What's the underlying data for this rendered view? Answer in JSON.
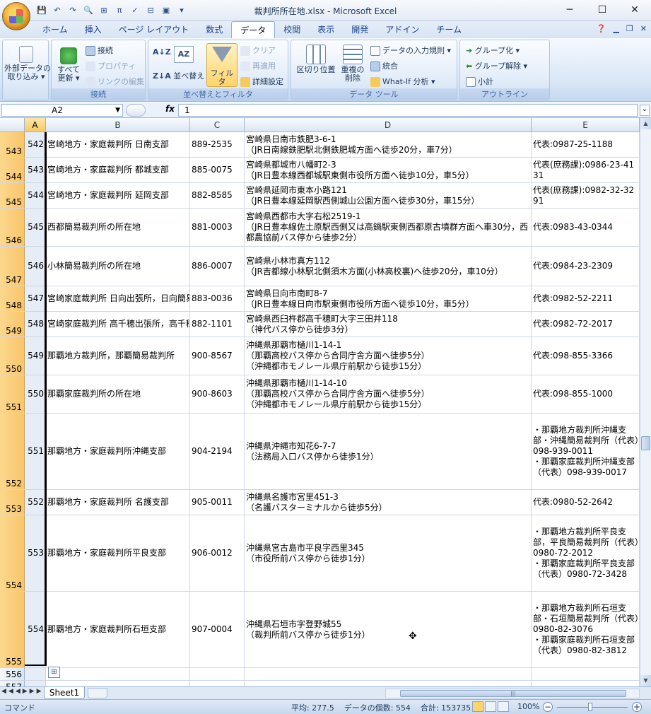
{
  "window": {
    "title": "裁判所所在地.xlsx - Microsoft Excel",
    "controls": [
      "─",
      "☐",
      "✕"
    ]
  },
  "qat": [
    "💾",
    "↶",
    "↷",
    "🔍",
    "⊞",
    "π",
    "✓",
    "⊟",
    "▣",
    "▾"
  ],
  "tabs": [
    "ホーム",
    "挿入",
    "ページ レイアウト",
    "数式",
    "データ",
    "校閲",
    "表示",
    "開発",
    "アドイン",
    "チーム"
  ],
  "active_tab": "データ",
  "ribbon": {
    "external_data": "外部データの\n取り込み ▾",
    "connections": {
      "refresh_all": "すべて\n更新 ▾",
      "connect": "接続",
      "properties": "プロパティ",
      "edit_links": "リンクの編集",
      "group": "接続"
    },
    "sort_filter": {
      "sort": "並べ替え",
      "filter": "フィルタ",
      "clear": "クリア",
      "reapply": "再適用",
      "advanced": "詳細設定",
      "group": "並べ替えとフィルタ"
    },
    "data_tools": {
      "text_to_columns": "区切り位置",
      "remove_duplicates": "重複の\n削除",
      "validation": "データの入力規則 ▾",
      "consolidate": "統合",
      "whatif": "What-If 分析 ▾",
      "group": "データ ツール"
    },
    "outline": {
      "group_btn": "グループ化 ▾",
      "ungroup": "グループ解除 ▾",
      "subtotal": "小計",
      "group": "アウトライン"
    }
  },
  "formula_bar": {
    "name_box": "A2",
    "fx": "fx",
    "value": "1"
  },
  "columns": [
    "A",
    "B",
    "C",
    "D",
    "E"
  ],
  "rows": [
    {
      "num": "543",
      "a": "542",
      "b": "宮崎地方・家庭裁判所 日南支部",
      "c": "889-2535",
      "d": "宮崎県日南市鉄肥3-6-1\n（JR日南線鉄肥駅北側鉄肥城方面へ徒歩20分，車7分）",
      "e": "代表:0987-25-1188",
      "h": 36
    },
    {
      "num": "544",
      "a": "543",
      "b": "宮崎地方・家庭裁判所 都城支部",
      "c": "885-0075",
      "d": "宮崎県都城市八幡町2-3\n（JR日豊本線西都城駅東側市役所方面へ徒歩10分，車5分）",
      "e": "代表(庶務課):0986-23-4131",
      "h": 36
    },
    {
      "num": "545",
      "a": "544",
      "b": "宮崎地方・家庭裁判所 延岡支部",
      "c": "882-8585",
      "d": "宮崎県延岡市東本小路121\n（JR日豊本線延岡駅西側城山公園方面へ徒歩30分，車15分）",
      "e": "代表(庶務課):0982-32-3291",
      "h": 36
    },
    {
      "num": "546",
      "a": "545",
      "b": "西都簡易裁判所の所在地",
      "c": "881-0003",
      "d": "宮崎県西都市大字右松2519-1\n（JR日豊本線佐土原駅西側又は高鍋駅東側西都原古墳群方面へ車30分，西都農協前バス停から徒歩2分）",
      "e": "代表:0983-43-0344",
      "h": 54
    },
    {
      "num": "547",
      "a": "546",
      "b": "小林簡易裁判所の所在地",
      "c": "886-0007",
      "d": "宮崎県小林市真方112\n（JR吉都線小林駅北側須木方面(小林高校裏)へ徒歩20分，車10分）",
      "e": "代表:0984-23-2309",
      "h": 56
    },
    {
      "num": "548",
      "a": "547",
      "b": "宮崎家庭裁判所 日向出張所，日向簡易裁判所",
      "c": "883-0036",
      "d": "宮崎県日向市南町8-7\n（JR日豊本線日向市駅東側市役所方面へ徒歩10分，車5分）",
      "e": "代表:0982-52-2211",
      "h": 36
    },
    {
      "num": "549",
      "a": "548",
      "b": "宮崎家庭裁判所 高千穂出張所，高千穂簡易裁判所",
      "c": "882-1101",
      "d": "宮崎県西臼杵郡高千穂町大字三田井118\n（神代バス停から徒歩3分）",
      "e": "代表:0982-72-2017",
      "h": 36
    },
    {
      "num": "550",
      "a": "549",
      "b": "那覇地方裁判所，那覇簡易裁判所",
      "c": "900-8567",
      "d": "沖縄県那覇市樋川1-14-1\n（那覇高校バス停から合同庁舎方面へ徒歩5分）\n（沖縄都市モノレール県庁前駅から徒歩15分）",
      "e": "代表:098-855-3366",
      "h": 54
    },
    {
      "num": "551",
      "a": "550",
      "b": "那覇家庭裁判所の所在地",
      "c": "900-8603",
      "d": "沖縄県那覇市樋川1-14-10\n（那覇高校バス停から合同庁舎方面へ徒歩5分）\n（沖縄都市モノレール県庁前駅から徒歩15分）",
      "e": "代表:098-855-1000",
      "h": 54
    },
    {
      "num": "552",
      "a": "551",
      "b": "那覇地方・家庭裁判所沖縄支部",
      "c": "904-2194",
      "d": "沖縄県沖縄市知花6-7-7\n（法務局入口バス停から徒歩1分）",
      "e": "・那覇地方裁判所沖縄支部・沖縄簡易裁判所（代表）098-939-0011\n・那覇家庭裁判所沖縄支部（代表）098-939-0017",
      "h": 108
    },
    {
      "num": "553",
      "a": "552",
      "b": "那覇地方・家庭裁判所 名護支部",
      "c": "905-0011",
      "d": "沖縄県名護市宮里451-3\n（名護バスターミナルから徒歩5分）",
      "e": "代表:0980-52-2642",
      "h": 36
    },
    {
      "num": "554",
      "a": "553",
      "b": "那覇地方・家庭裁判所平良支部",
      "c": "906-0012",
      "d": "沖縄県宮古島市平良字西里345\n（市役所前バス停から徒歩1分）",
      "e": "・那覇地方裁判所平良支部，平良簡易裁判所（代表）0980-72-2012\n・那覇家庭裁判所平良支部（代表）0980-72-3428",
      "h": 108
    },
    {
      "num": "555",
      "a": "554",
      "b": "那覇地方・家庭裁判所石垣支部",
      "c": "907-0004",
      "d": "沖縄県石垣市字登野城55\n（裁判所前バス停から徒歩1分）",
      "e": "・那覇地方裁判所石垣支部・石垣簡易裁判所（代表）0980-82-3076\n・那覇家庭裁判所石垣支部（代表）0980-82-3812",
      "h": 108
    },
    {
      "num": "556",
      "a": "",
      "b": "",
      "c": "",
      "d": "",
      "e": "",
      "h": 18,
      "plain": true
    },
    {
      "num": "557",
      "a": "",
      "b": "",
      "c": "",
      "d": "",
      "e": "",
      "h": 18,
      "plain": true
    }
  ],
  "sheet_tab": "Sheet1",
  "status": {
    "mode": "コマンド",
    "average": "平均: 277.5",
    "count": "データの個数: 554",
    "sum": "合計: 153735",
    "zoom": "100%"
  }
}
